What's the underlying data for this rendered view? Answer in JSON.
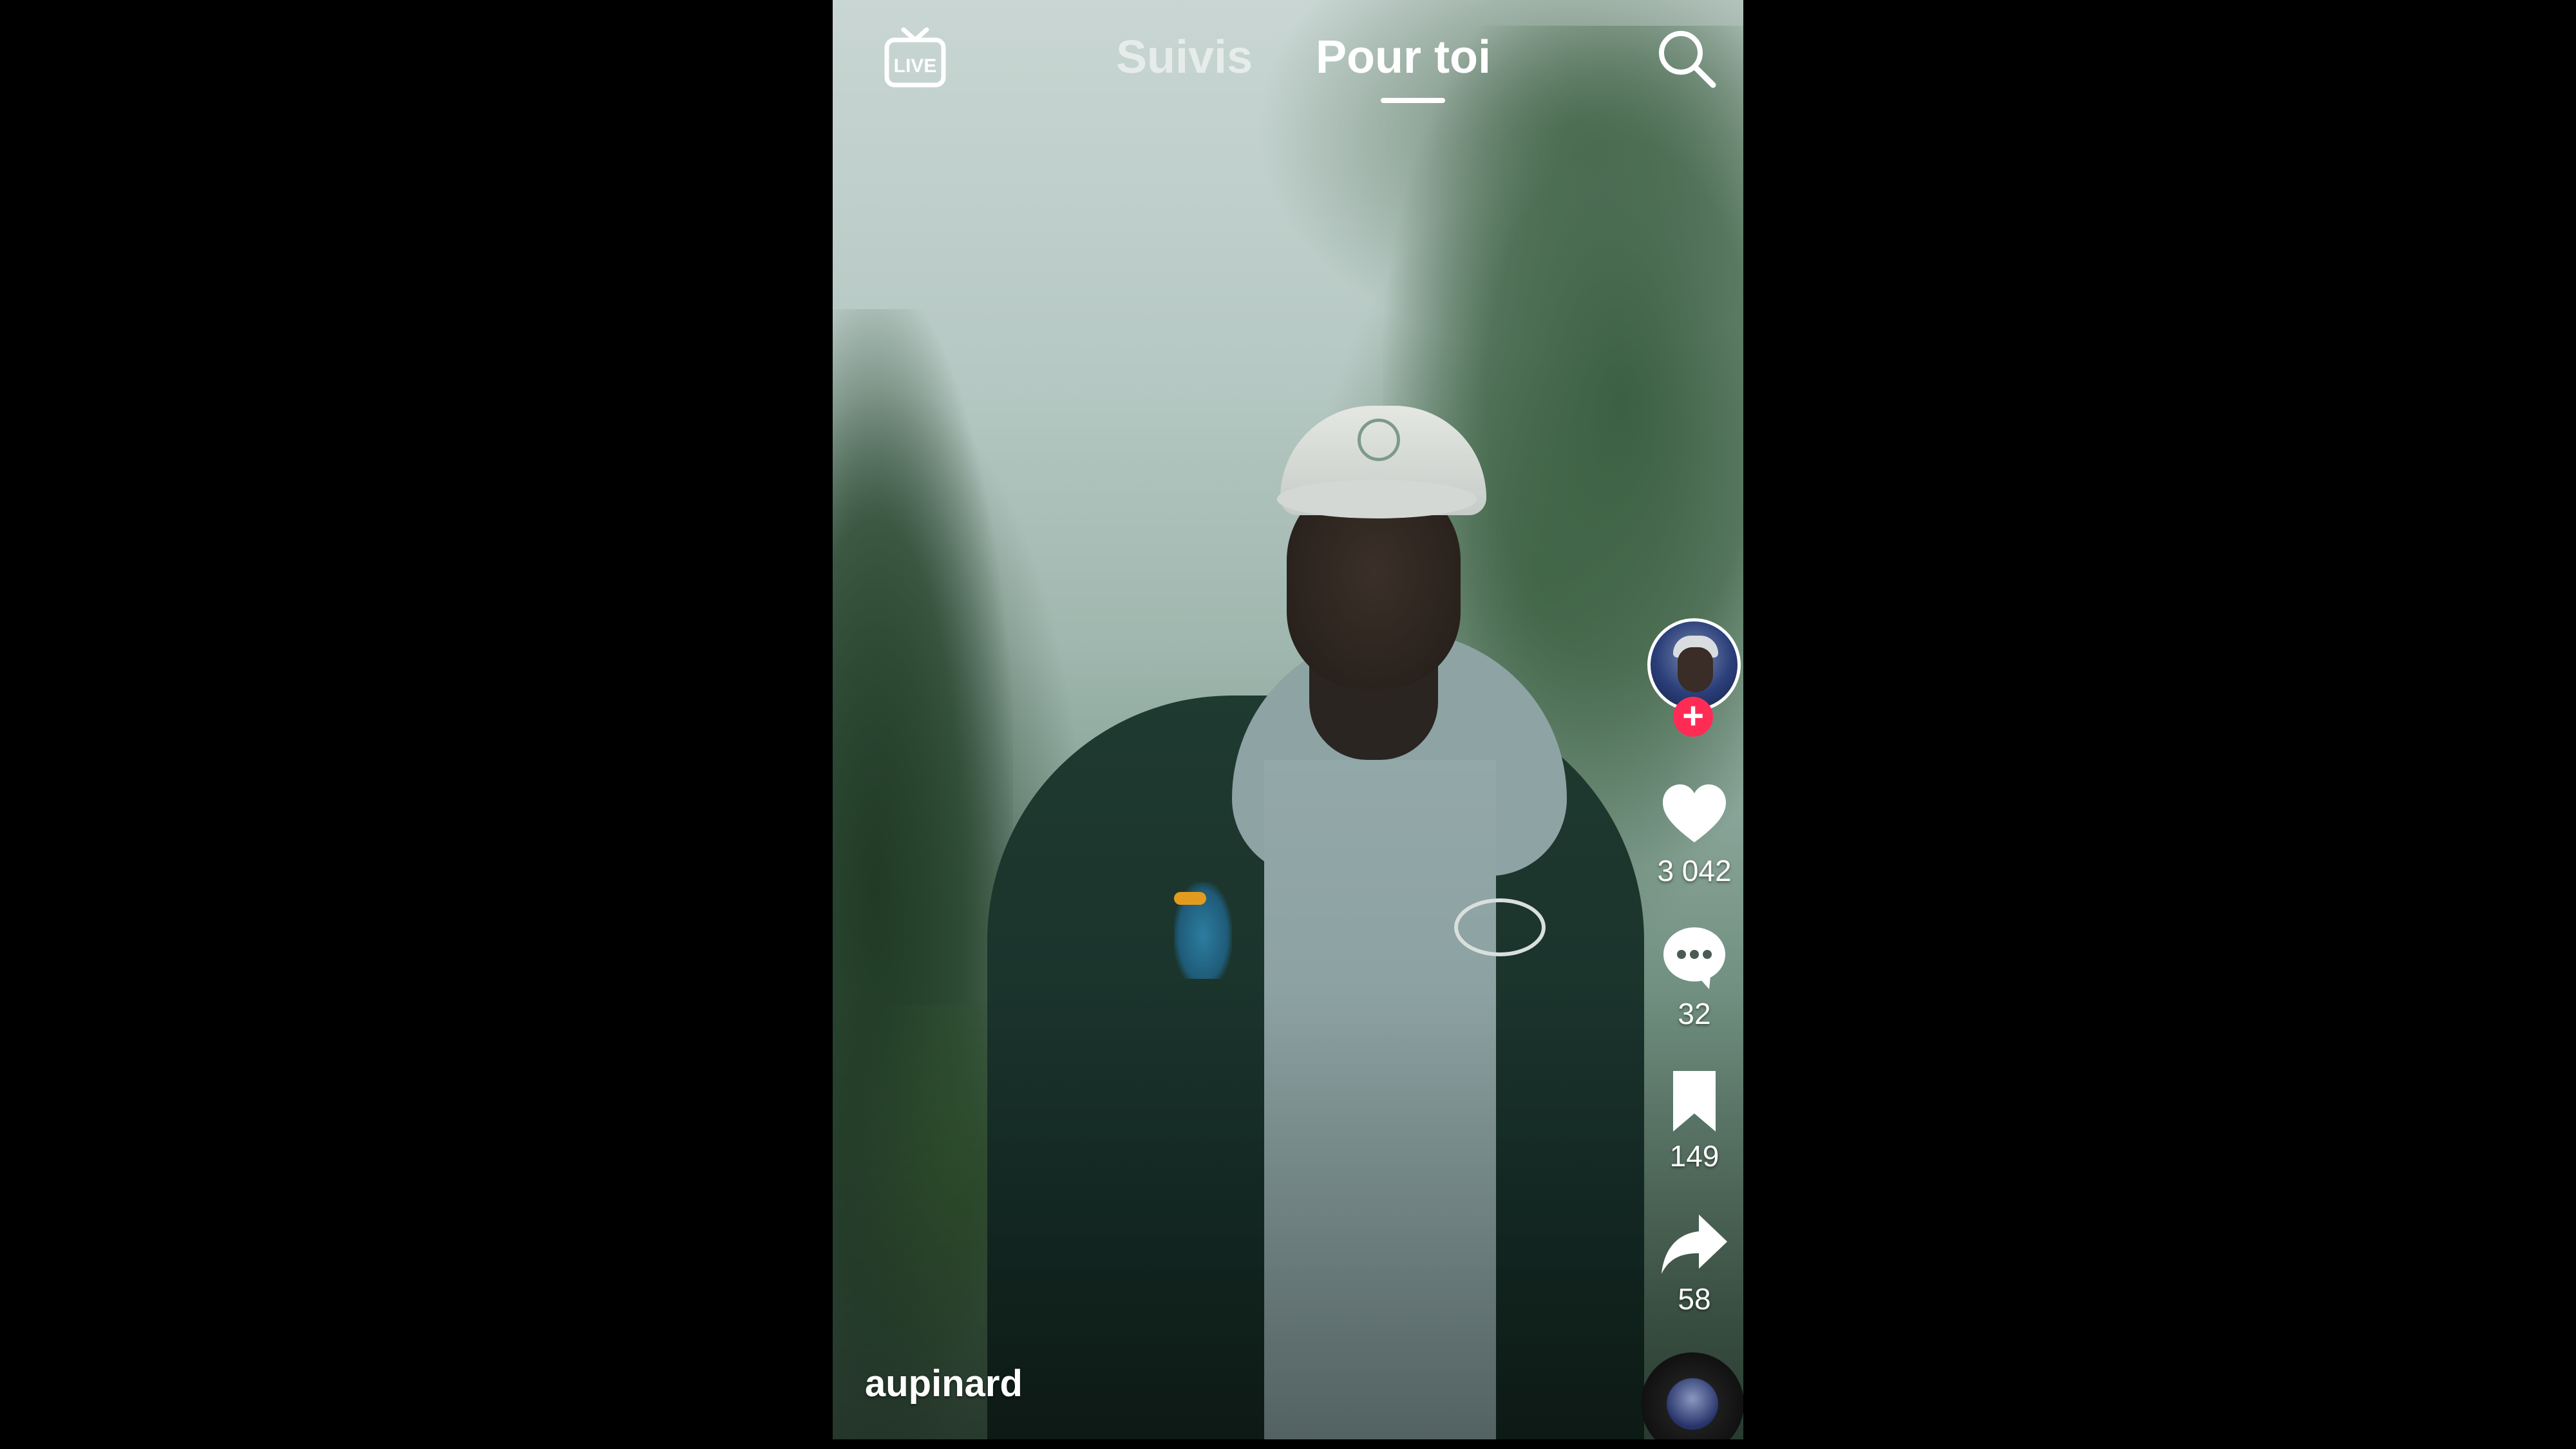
{
  "top_bar": {
    "live_icon": "live-tv-icon",
    "tabs": [
      {
        "label": "Suivis",
        "active": false
      },
      {
        "label": "Pour toi",
        "active": true
      }
    ],
    "search_icon": "search-icon"
  },
  "video": {
    "username": "aupinard"
  },
  "right_rail": {
    "follow_icon": "plus-icon",
    "likes": "3 042",
    "comments": "32",
    "saves": "149",
    "shares": "58"
  },
  "colors": {
    "follow_accent": "#fe2c55",
    "text": "#ffffff",
    "inactive_tab": "rgba(255,255,255,0.55)"
  }
}
